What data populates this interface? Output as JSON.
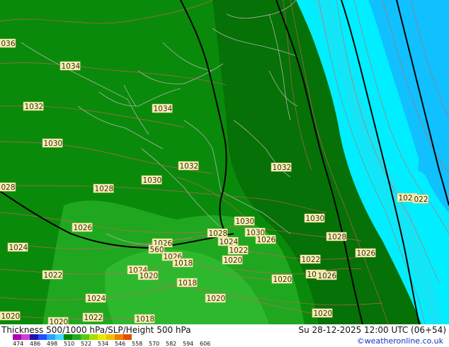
{
  "product_title": "Thickness 500/1000 hPa/SLP/Height 500 hPa",
  "valid_time": "Su 28-12-2025 12:00 UTC (06+54)",
  "credit": "©weatheronline.co.uk",
  "colors": {
    "thickness_534": "#0a8a0a",
    "thickness_546": "#1fa81f",
    "thickness_522": "#067106",
    "thickness_510_cyan": "#00eeff",
    "thickness_498": "#10c0ff",
    "slp_isobar": "#d06060",
    "height_500_contour": "#000000",
    "coastline": "#b0b0b0",
    "label_bg": "#f5f0b8"
  },
  "legend": {
    "swatches": [
      "#b000b0",
      "#d040d0",
      "#2010b0",
      "#2050ff",
      "#30a0ff",
      "#40d8ff",
      "#008800",
      "#22aa22",
      "#55cc11",
      "#aadd00",
      "#e8e800",
      "#f0c000",
      "#f08000",
      "#e05000"
    ],
    "ticks": [
      "474",
      "486",
      "498",
      "510",
      "522",
      "534",
      "546",
      "558",
      "570",
      "582",
      "594",
      "606"
    ]
  },
  "pressure_labels": [
    {
      "text": "036"
    },
    {
      "text": "1034"
    },
    {
      "text": "1032"
    },
    {
      "text": "1034"
    },
    {
      "text": "1030"
    },
    {
      "text": "1032"
    },
    {
      "text": "1030"
    },
    {
      "text": "1032"
    },
    {
      "text": "028"
    },
    {
      "text": "1028"
    },
    {
      "text": "1030"
    },
    {
      "text": "1030"
    },
    {
      "text": "1026"
    },
    {
      "text": "1028"
    },
    {
      "text": "1030"
    },
    {
      "text": "1028"
    },
    {
      "text": "1024"
    },
    {
      "text": "1026"
    },
    {
      "text": "1024"
    },
    {
      "text": "1022"
    },
    {
      "text": "1026"
    },
    {
      "text": "560"
    },
    {
      "text": "1026"
    },
    {
      "text": "1018"
    },
    {
      "text": "1020"
    },
    {
      "text": "1022"
    },
    {
      "text": "1024"
    },
    {
      "text": "1020"
    },
    {
      "text": "1022"
    },
    {
      "text": "1018"
    },
    {
      "text": "1020"
    },
    {
      "text": "1018"
    },
    {
      "text": "1026"
    },
    {
      "text": "1026"
    },
    {
      "text": "1022"
    },
    {
      "text": "1024"
    },
    {
      "text": "1020"
    },
    {
      "text": "1020"
    },
    {
      "text": "1020"
    },
    {
      "text": "1022"
    },
    {
      "text": "1018"
    },
    {
      "text": "1020"
    },
    {
      "text": "1020"
    },
    {
      "text": "1024"
    },
    {
      "text": "022"
    }
  ]
}
